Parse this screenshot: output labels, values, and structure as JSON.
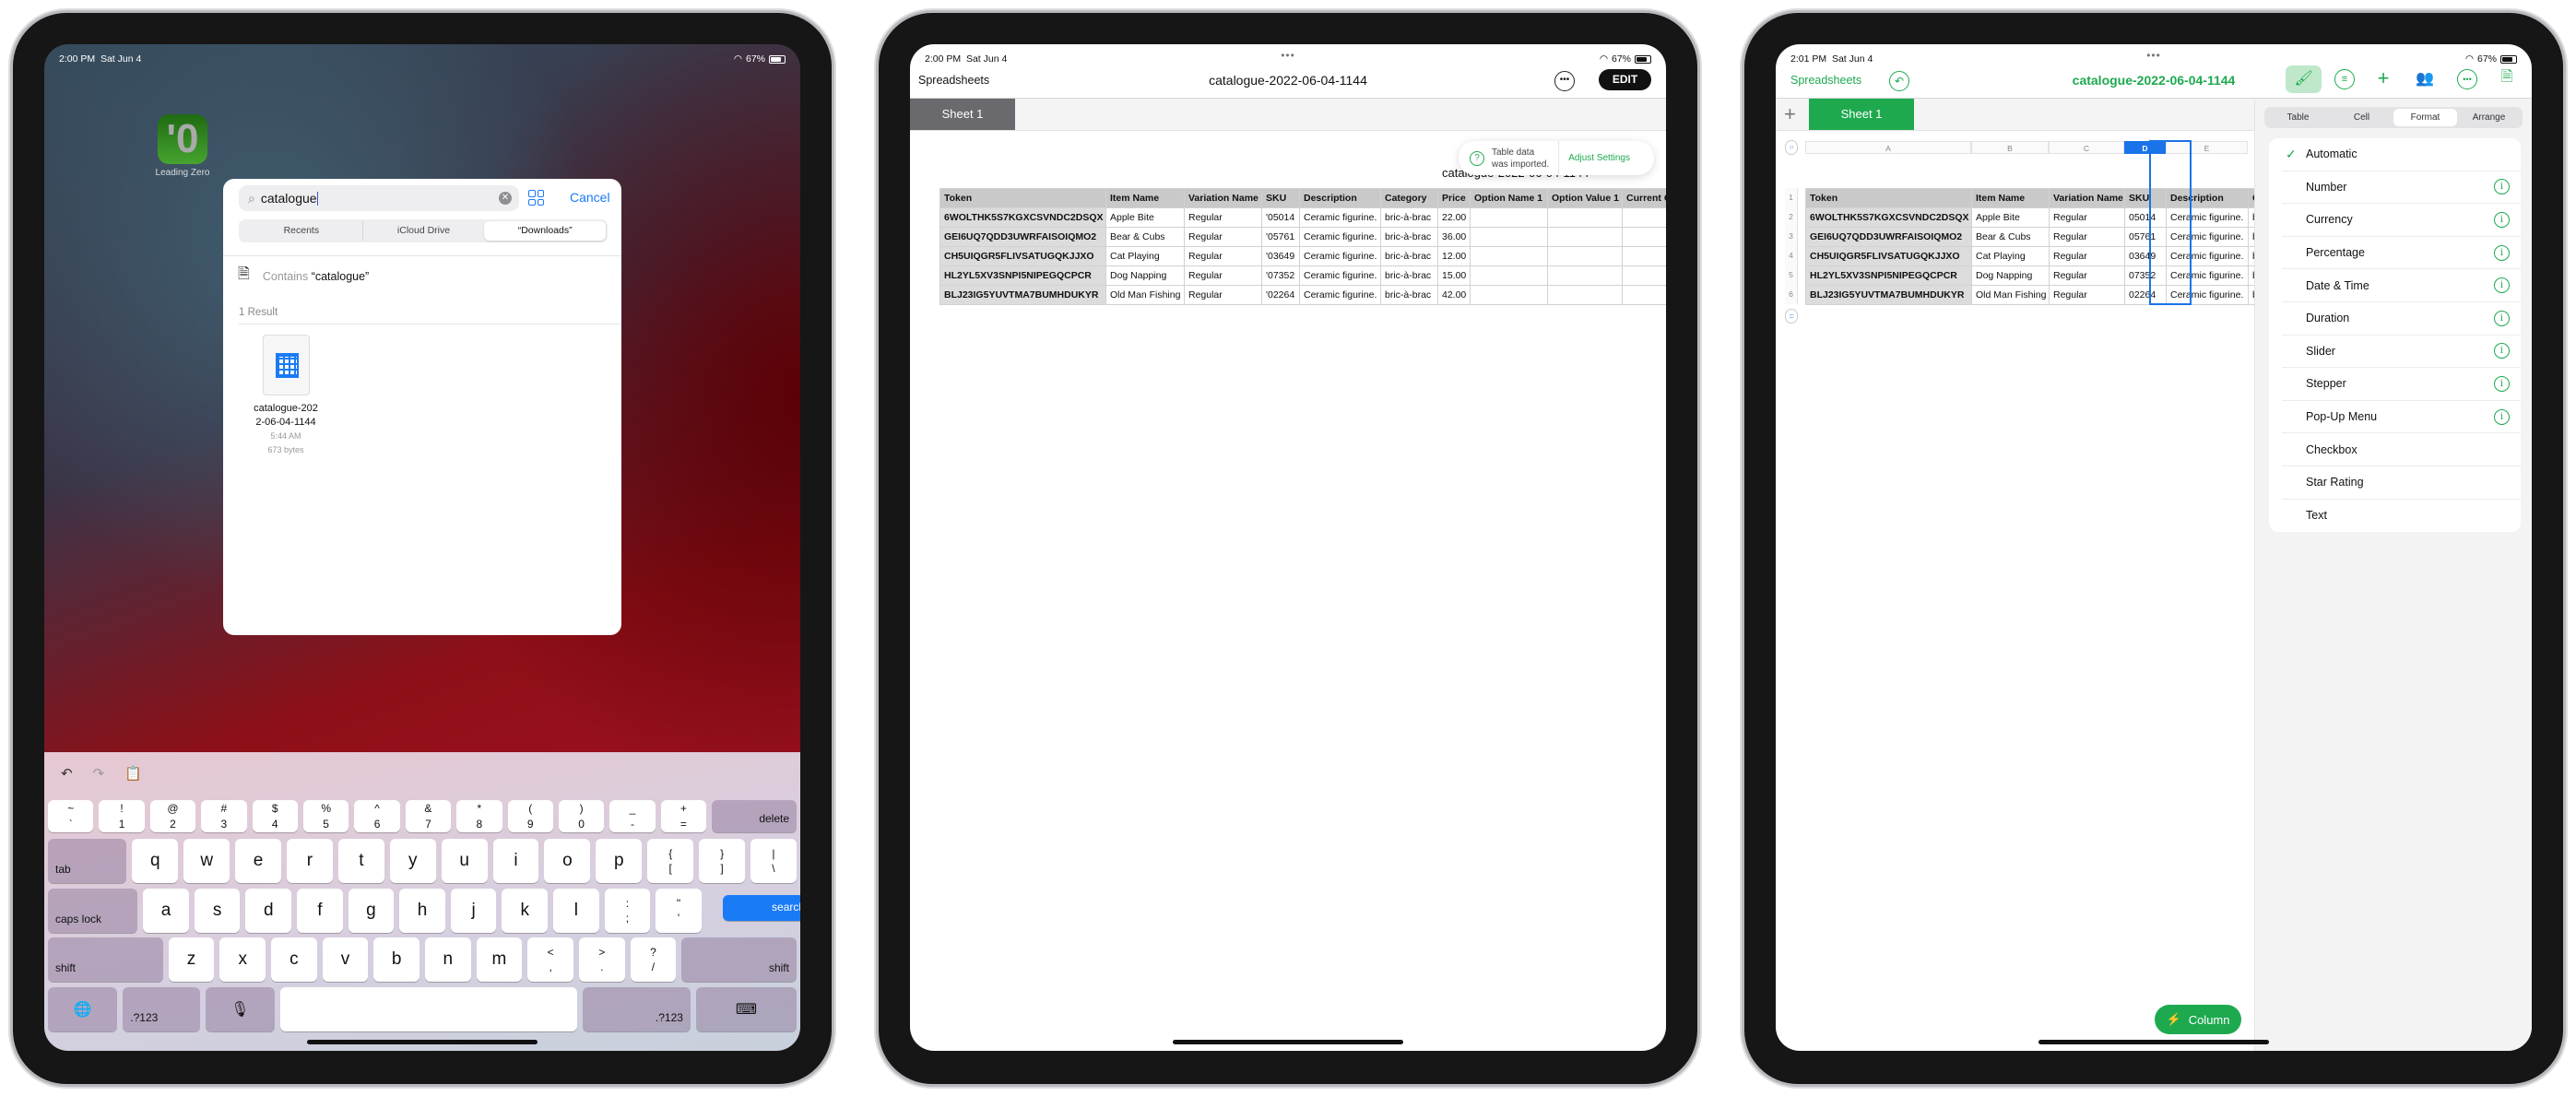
{
  "colors": {
    "ios_blue": "#1a7bf6",
    "numbers_green": "#1ea94f",
    "selection_blue": "#1a73e8"
  },
  "screen1": {
    "status": {
      "time": "2:00 PM",
      "date": "Sat Jun 4",
      "battery": "67%"
    },
    "app_icon": {
      "glyph": "'0",
      "label": "Leading Zero"
    },
    "picker": {
      "search_value": "catalogue",
      "cancel": "Cancel",
      "scopes": [
        "Recents",
        "iCloud Drive",
        "“Downloads”"
      ],
      "contains_prefix": "Contains ",
      "contains_term": "“catalogue”",
      "results_header": "1 Result",
      "file": {
        "name_line1": "catalogue-202",
        "name_line2": "2-06-04-1144",
        "time": "5:44 AM",
        "size": "673 bytes"
      }
    },
    "keyboard": {
      "rows": [
        [
          {
            "t": "~",
            "b": "`"
          },
          {
            "t": "!",
            "b": "1"
          },
          {
            "t": "@",
            "b": "2"
          },
          {
            "t": "#",
            "b": "3"
          },
          {
            "t": "$",
            "b": "4"
          },
          {
            "t": "%",
            "b": "5"
          },
          {
            "t": "^",
            "b": "6"
          },
          {
            "t": "&",
            "b": "7"
          },
          {
            "t": "*",
            "b": "8"
          },
          {
            "t": "(",
            "b": "9"
          },
          {
            "t": ")",
            "b": "0"
          },
          {
            "t": "_",
            "b": "-"
          },
          {
            "t": "+",
            "b": "="
          },
          {
            "fn": "delete",
            "align": "r"
          }
        ],
        [
          {
            "fn": "tab"
          },
          {
            "k": "q"
          },
          {
            "k": "w"
          },
          {
            "k": "e"
          },
          {
            "k": "r"
          },
          {
            "k": "t"
          },
          {
            "k": "y"
          },
          {
            "k": "u"
          },
          {
            "k": "i"
          },
          {
            "k": "o"
          },
          {
            "k": "p"
          },
          {
            "t": "{",
            "b": "["
          },
          {
            "t": "}",
            "b": "]"
          },
          {
            "t": "|",
            "b": "\\"
          }
        ],
        [
          {
            "fn": "caps lock"
          },
          {
            "k": "a"
          },
          {
            "k": "s"
          },
          {
            "k": "d"
          },
          {
            "k": "f"
          },
          {
            "k": "g"
          },
          {
            "k": "h"
          },
          {
            "k": "j"
          },
          {
            "k": "k"
          },
          {
            "k": "l"
          },
          {
            "t": ":",
            "b": ";"
          },
          {
            "t": "\"",
            "b": "'"
          },
          {
            "fn": "search",
            "align": "r",
            "special": "search"
          }
        ],
        [
          {
            "fn": "shift"
          },
          {
            "k": "z"
          },
          {
            "k": "x"
          },
          {
            "k": "c"
          },
          {
            "k": "v"
          },
          {
            "k": "b"
          },
          {
            "k": "n"
          },
          {
            "k": "m"
          },
          {
            "t": "<",
            "b": ","
          },
          {
            "t": ">",
            "b": "."
          },
          {
            "t": "?",
            "b": "/"
          },
          {
            "fn": "shift",
            "align": "r"
          }
        ],
        [
          {
            "icon": "globe",
            "g": "🌐"
          },
          {
            "fn": ".?123"
          },
          {
            "icon": "microphone",
            "g": "🎙"
          },
          {
            "space": ""
          },
          {
            "fn": ".?123",
            "align": "r"
          },
          {
            "icon": "keyboard-dismiss",
            "g": "⌨"
          }
        ]
      ]
    }
  },
  "screen2": {
    "status": {
      "time": "2:00 PM",
      "date": "Sat Jun 4",
      "battery": "67%"
    },
    "back": "Spreadsheets",
    "title": "catalogue-2022-06-04-1144",
    "edit": "EDIT",
    "sheet_tab": "Sheet 1",
    "toast": {
      "line1": "Table data",
      "line2": "was imported.",
      "action": "Adjust Settings"
    },
    "table_title": "catalogue-2022-06-04-1144",
    "table": {
      "headers": [
        "Token",
        "Item Name",
        "Variation Name",
        "SKU",
        "Description",
        "Category",
        "Price",
        "Option Name 1",
        "Option Value 1",
        "Current Q"
      ],
      "rows": [
        [
          "6WOLTHK5S7KGXCSVNDC2DSQX",
          "Apple Bite",
          "Regular",
          "'05014",
          "Ceramic figurine.",
          "bric-à-brac",
          "22.00",
          "",
          "",
          ""
        ],
        [
          "GEI6UQ7QDD3UWRFAISOIQMO2",
          "Bear & Cubs",
          "Regular",
          "'05761",
          "Ceramic figurine.",
          "bric-à-brac",
          "36.00",
          "",
          "",
          ""
        ],
        [
          "CH5UIQGR5FLIVSATUGQKJJXO",
          "Cat Playing",
          "Regular",
          "'03649",
          "Ceramic figurine.",
          "bric-à-brac",
          "12.00",
          "",
          "",
          ""
        ],
        [
          "HL2YL5XV3SNPI5NIPEGQCPCR",
          "Dog Napping",
          "Regular",
          "'07352",
          "Ceramic figurine.",
          "bric-à-brac",
          "15.00",
          "",
          "",
          ""
        ],
        [
          "BLJ23IG5YUVTMA7BUMHDUKYR",
          "Old Man Fishing",
          "Regular",
          "'02264",
          "Ceramic figurine.",
          "bric-à-brac",
          "42.00",
          "",
          "",
          ""
        ]
      ]
    }
  },
  "screen3": {
    "status": {
      "time": "2:01 PM",
      "date": "Sat Jun 4",
      "battery": "67%"
    },
    "back": "Spreadsheets",
    "title": "catalogue-2022-06-04-1144",
    "sheet_tab": "Sheet 1",
    "column_letters": [
      "A",
      "B",
      "C",
      "D",
      "E"
    ],
    "row_numbers": [
      "1",
      "2",
      "3",
      "4",
      "5",
      "6"
    ],
    "selected_column": "D",
    "table": {
      "headers": [
        "Token",
        "Item Name",
        "Variation Name",
        "SKU",
        "Description",
        "C"
      ],
      "rows": [
        [
          "6WOLTHK5S7KGXCSVNDC2DSQX",
          "Apple Bite",
          "Regular",
          "05014",
          "Ceramic figurine.",
          "b"
        ],
        [
          "GEI6UQ7QDD3UWRFAISOIQMO2",
          "Bear & Cubs",
          "Regular",
          "05761",
          "Ceramic figurine.",
          "b"
        ],
        [
          "CH5UIQGR5FLIVSATUGQKJJXO",
          "Cat Playing",
          "Regular",
          "03649",
          "Ceramic figurine.",
          "b"
        ],
        [
          "HL2YL5XV3SNPI5NIPEGQCPCR",
          "Dog Napping",
          "Regular",
          "07352",
          "Ceramic figurine.",
          "b"
        ],
        [
          "BLJ23IG5YUVTMA7BUMHDUKYR",
          "Old Man Fishing",
          "Regular",
          "02264",
          "Ceramic figurine.",
          "b"
        ]
      ]
    },
    "panel": {
      "tabs": [
        "Table",
        "Cell",
        "Format",
        "Arrange"
      ],
      "active_tab": "Format",
      "formats": [
        {
          "label": "Automatic",
          "checked": true,
          "info": false
        },
        {
          "label": "Number",
          "info": true
        },
        {
          "label": "Currency",
          "info": true
        },
        {
          "label": "Percentage",
          "info": true
        },
        {
          "label": "Date & Time",
          "info": true
        },
        {
          "label": "Duration",
          "info": true
        },
        {
          "label": "Slider",
          "info": true
        },
        {
          "label": "Stepper",
          "info": true
        },
        {
          "label": "Pop-Up Menu",
          "info": true
        },
        {
          "label": "Checkbox",
          "info": false
        },
        {
          "label": "Star Rating",
          "info": false
        },
        {
          "label": "Text",
          "info": false
        }
      ]
    },
    "column_button": "Column"
  }
}
